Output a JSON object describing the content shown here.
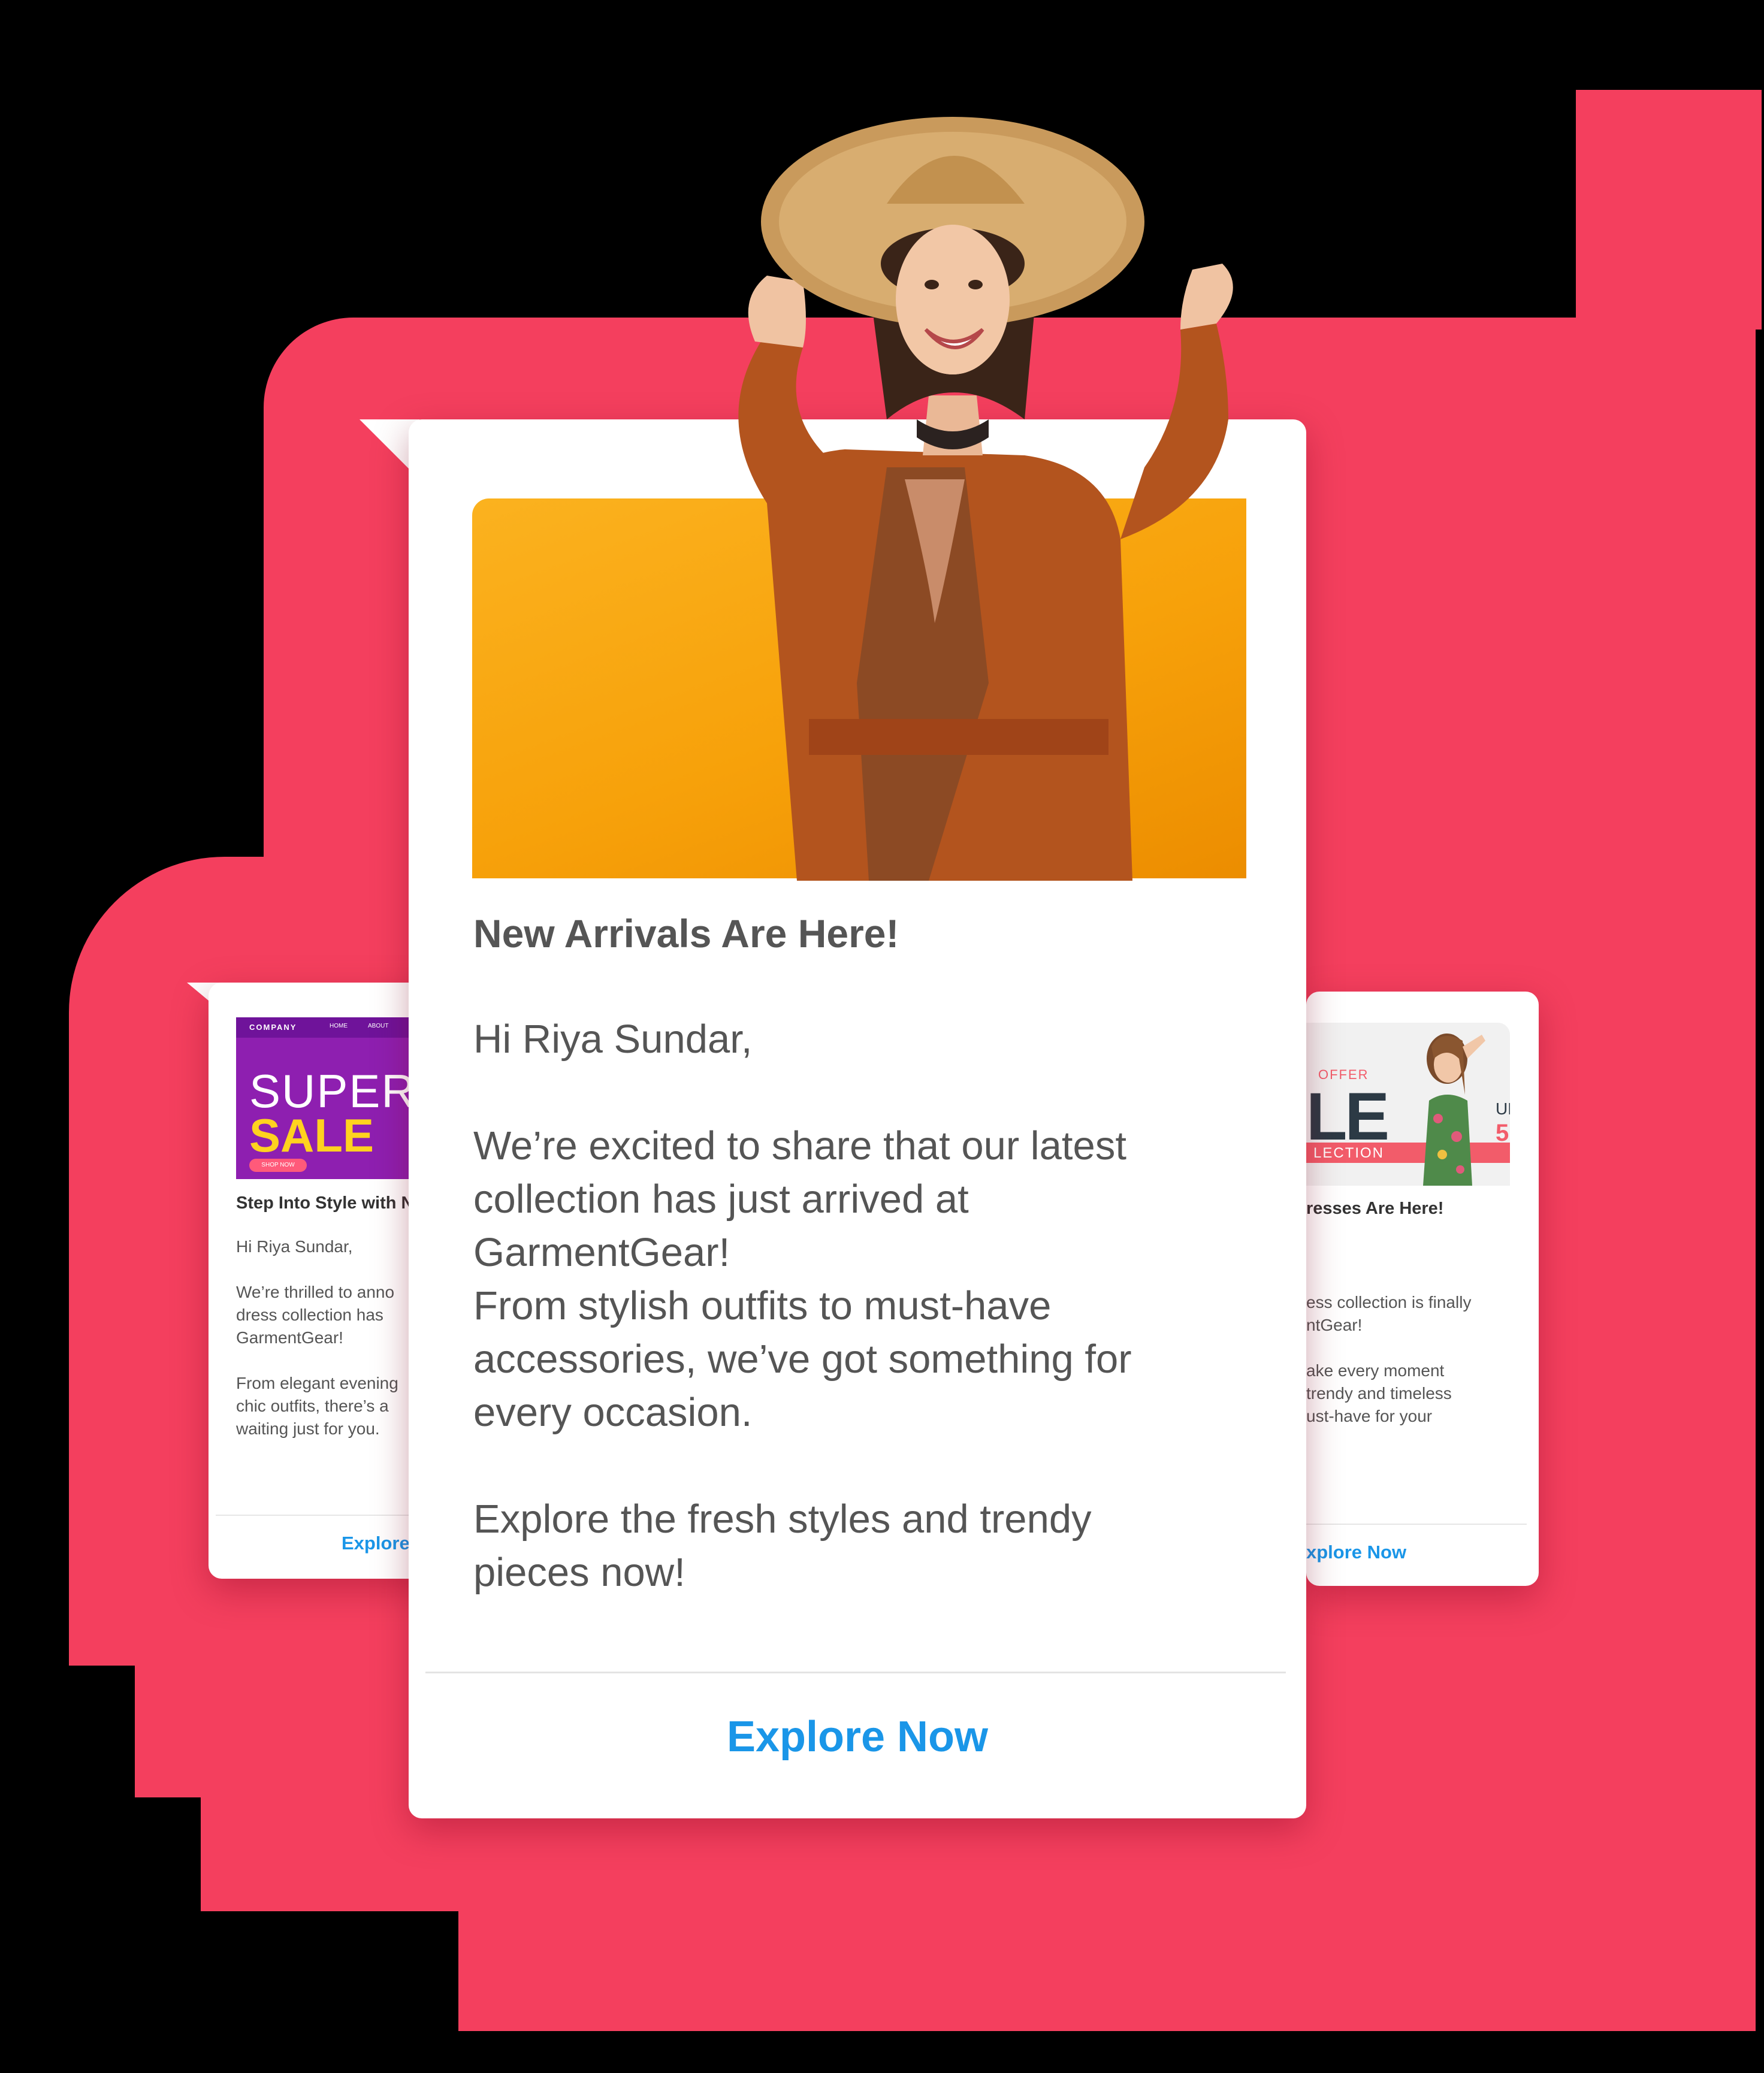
{
  "colors": {
    "backdrop": "#f43f5e",
    "card": "#ffffff",
    "accent_link": "#1a96e8",
    "hero_orange": "#f7a10a",
    "sale_purple": "#8e1fb0",
    "sale_yellow": "#ffd21f"
  },
  "left_card": {
    "banner": {
      "nav_brand": "COMPANY",
      "nav_home": "HOME",
      "nav_about": "ABOUT",
      "super_text": "SUPER",
      "sale_text": "SALE",
      "shop_button": "SHOP NOW"
    },
    "title": "Step Into Style with N",
    "body": "Hi Riya Sundar,\n\nWe’re thrilled to anno\ndress collection has\nGarmentGear!\n\nFrom elegant evening\nchic outfits, there’s a\nwaiting just for you.",
    "cta": "Explore"
  },
  "right_card": {
    "banner": {
      "offer_text": "OFFER",
      "sale_fragment": "LE",
      "collection_text": "LECTION",
      "up_text": "UP",
      "percent_fragment": "5"
    },
    "title": "resses Are Here!",
    "body": "ess collection is finally\nntGear!\n\nake every moment\ntrendy and timeless\nust-have for your",
    "cta": "xplore Now"
  },
  "main_card": {
    "title": "New Arrivals Are Here!",
    "body": "Hi Riya Sundar,\n\nWe’re excited to share that our latest\ncollection has just arrived at\nGarmentGear!\nFrom stylish outfits to must-have\naccessories, we’ve got something for\nevery occasion.\n\nExplore the fresh styles and trendy\npieces now!",
    "cta": "Explore Now"
  }
}
